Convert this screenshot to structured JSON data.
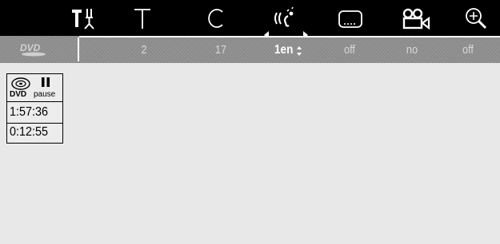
{
  "menu": {
    "icons": [
      {
        "name": "settings-icon",
        "selected": false
      },
      {
        "name": "title-icon",
        "selected": false
      },
      {
        "name": "chapter-icon",
        "selected": false
      },
      {
        "name": "audio-language-icon",
        "selected": true
      },
      {
        "name": "subtitle-icon",
        "selected": false
      },
      {
        "name": "camera-angle-icon",
        "selected": false
      },
      {
        "name": "zoom-icon",
        "selected": false
      }
    ],
    "values": {
      "title": "2",
      "chapter": "17",
      "audio": "1en",
      "subtitle": "off",
      "angle": "no",
      "zoom": "off"
    }
  },
  "disc": {
    "logo": "DVD",
    "type_label": "DVD",
    "state_label": "pause",
    "total_time": "1:57:36",
    "elapsed_time": "0:12:55"
  },
  "colors": {
    "top_bar": "#000000",
    "value_bar": "#8f8f8f",
    "background": "#e8e8e8",
    "highlight": "#ffffff"
  }
}
